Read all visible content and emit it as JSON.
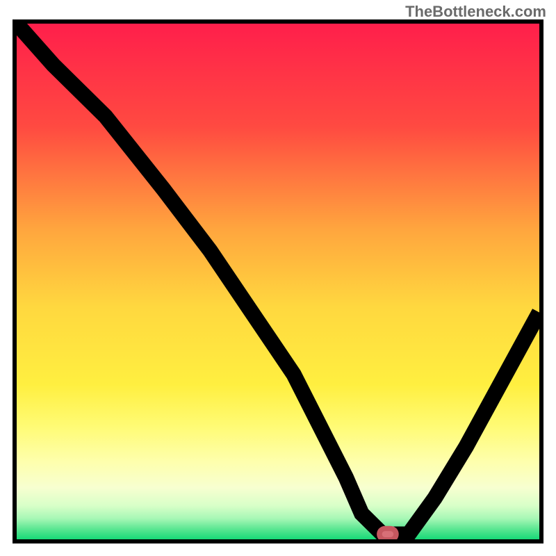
{
  "watermark": "TheBottleneck.com",
  "chart_data": {
    "type": "line",
    "title": "",
    "xlabel": "",
    "ylabel": "",
    "xlim": [
      0,
      100
    ],
    "ylim": [
      0,
      100
    ],
    "x": [
      0,
      7,
      17,
      28,
      37,
      45,
      53,
      58,
      63,
      66,
      70,
      75,
      80,
      86,
      93,
      100
    ],
    "y": [
      100,
      92,
      82,
      68,
      56,
      44,
      32,
      22,
      12,
      5,
      1,
      1,
      8,
      18,
      31,
      44
    ],
    "marker": {
      "x": 71,
      "y": 1,
      "label": "bottleneck-point"
    },
    "gradient_stops": [
      {
        "pos": 0.0,
        "color": "#ff1f4b"
      },
      {
        "pos": 0.2,
        "color": "#ff4a41"
      },
      {
        "pos": 0.4,
        "color": "#ffa63e"
      },
      {
        "pos": 0.55,
        "color": "#ffd83f"
      },
      {
        "pos": 0.7,
        "color": "#ffef40"
      },
      {
        "pos": 0.78,
        "color": "#fffb74"
      },
      {
        "pos": 0.85,
        "color": "#feffad"
      },
      {
        "pos": 0.9,
        "color": "#f7ffd0"
      },
      {
        "pos": 0.935,
        "color": "#d8ffc8"
      },
      {
        "pos": 0.96,
        "color": "#a6f7b5"
      },
      {
        "pos": 0.98,
        "color": "#5be692"
      },
      {
        "pos": 1.0,
        "color": "#17d977"
      }
    ]
  }
}
